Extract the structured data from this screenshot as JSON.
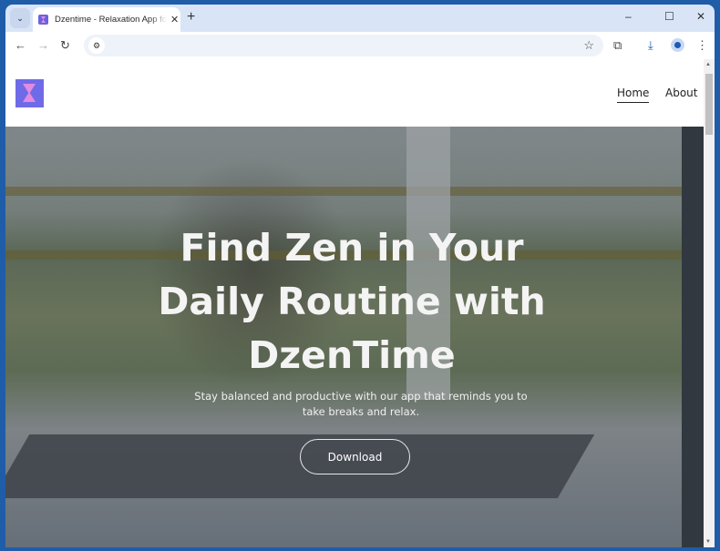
{
  "browser": {
    "tab_title": "Dzentime - Relaxation App for Daily Breaks",
    "tab_close": "✕",
    "new_tab": "+",
    "tab_list": "⌄",
    "window_controls": {
      "minimize": "–",
      "maximize": "☐",
      "close": "✕"
    },
    "nav": {
      "back": "←",
      "forward": "→",
      "reload": "↻"
    },
    "url": "",
    "icons": {
      "site_info": "⚙",
      "bookmark": "☆",
      "extensions": "⧉",
      "download": "⤓",
      "menu": "⋮"
    }
  },
  "site": {
    "nav": [
      {
        "label": "Home",
        "active": true
      },
      {
        "label": "About",
        "active": false
      }
    ],
    "hero": {
      "title": "Find Zen in Your Daily Routine with DzenTime",
      "subtitle": "Stay balanced and productive with our app that reminds you to take breaks and relax.",
      "button": "Download"
    }
  },
  "scrollbar": {
    "up": "▲",
    "down": "▼"
  }
}
